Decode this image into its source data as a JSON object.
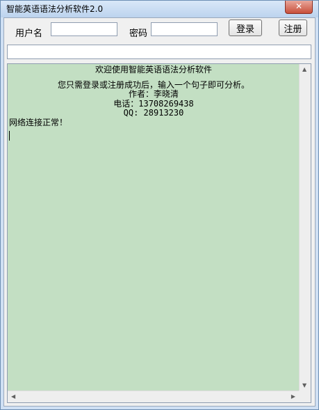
{
  "window": {
    "title": "智能英语语法分析软件2.0",
    "close_icon": "close-icon",
    "close_glyph": "✕"
  },
  "login": {
    "username_label": "用户名",
    "username_value": "",
    "password_label": "密码",
    "password_value": "",
    "login_button": "登录",
    "register_button": "注册"
  },
  "sentence_input": {
    "value": ""
  },
  "output": {
    "lines": [
      "欢迎使用智能英语语法分析软件",
      "您只需登录或注册成功后，输入一个句子即可分析。",
      "作者：李晓清",
      "电话：13708269438",
      "QQ: 28913230",
      "网络连接正常！"
    ]
  },
  "scrollbars": {
    "up_icon": "scroll-up-arrow-icon",
    "down_icon": "scroll-down-arrow-icon",
    "left_icon": "scroll-left-arrow-icon",
    "right_icon": "scroll-right-arrow-icon"
  },
  "colors": {
    "output_background": "#c3dfc3",
    "window_chrome": "#cfe0f4",
    "close_button": "#c84f3a"
  }
}
